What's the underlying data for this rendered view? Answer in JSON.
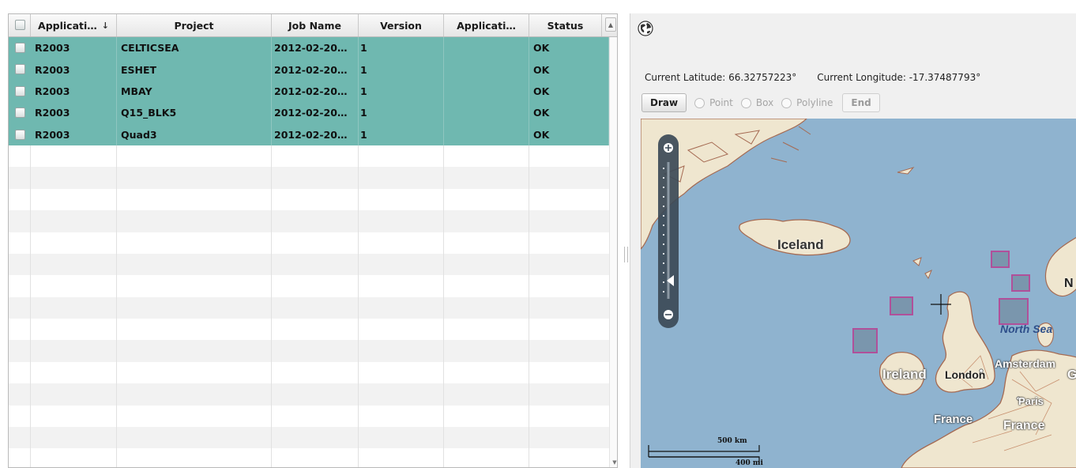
{
  "grid": {
    "columns": [
      {
        "label": "Applicati…",
        "sort_icon": "↓"
      },
      {
        "label": "Project"
      },
      {
        "label": "Job Name"
      },
      {
        "label": "Version"
      },
      {
        "label": "Applicati…"
      },
      {
        "label": "Status"
      }
    ],
    "rows": [
      {
        "application": "R2003",
        "project": "CELTICSEA",
        "job_name": "2012-02-20…",
        "version": "1",
        "application2": "",
        "status": "OK"
      },
      {
        "application": "R2003",
        "project": "ESHET",
        "job_name": "2012-02-20…",
        "version": "1",
        "application2": "",
        "status": "OK"
      },
      {
        "application": "R2003",
        "project": "MBAY",
        "job_name": "2012-02-20…",
        "version": "1",
        "application2": "",
        "status": "OK"
      },
      {
        "application": "R2003",
        "project": "Q15_BLK5",
        "job_name": "2012-02-20…",
        "version": "1",
        "application2": "",
        "status": "OK"
      },
      {
        "application": "R2003",
        "project": "Quad3",
        "job_name": "2012-02-20…",
        "version": "1",
        "application2": "",
        "status": "OK"
      }
    ],
    "selected_row_color": "#6fb8b0"
  },
  "map_panel": {
    "globe_icon": "globe-icon",
    "latitude": "Current Latitude: 66.32757223°",
    "longitude": "Current Longitude: -17.37487793°",
    "toolbar": {
      "draw_label": "Draw",
      "point_label": "Point",
      "box_label": "Box",
      "polyline_label": "Polyline",
      "end_label": "End"
    },
    "map": {
      "labels": {
        "iceland": "Iceland",
        "north_sea": "North Sea",
        "ireland": "Ireland",
        "london": "London",
        "amsterdam": "Amsterdam",
        "paris": "Paris",
        "france1": "France",
        "france2": "France",
        "no_partial": "N",
        "g_partial": "G"
      },
      "scale_km": "500 km",
      "scale_mi": "400 mi",
      "sea_color": "#8fb3cf",
      "land_color": "#efe6cf",
      "box_color": "#b0509a"
    }
  }
}
